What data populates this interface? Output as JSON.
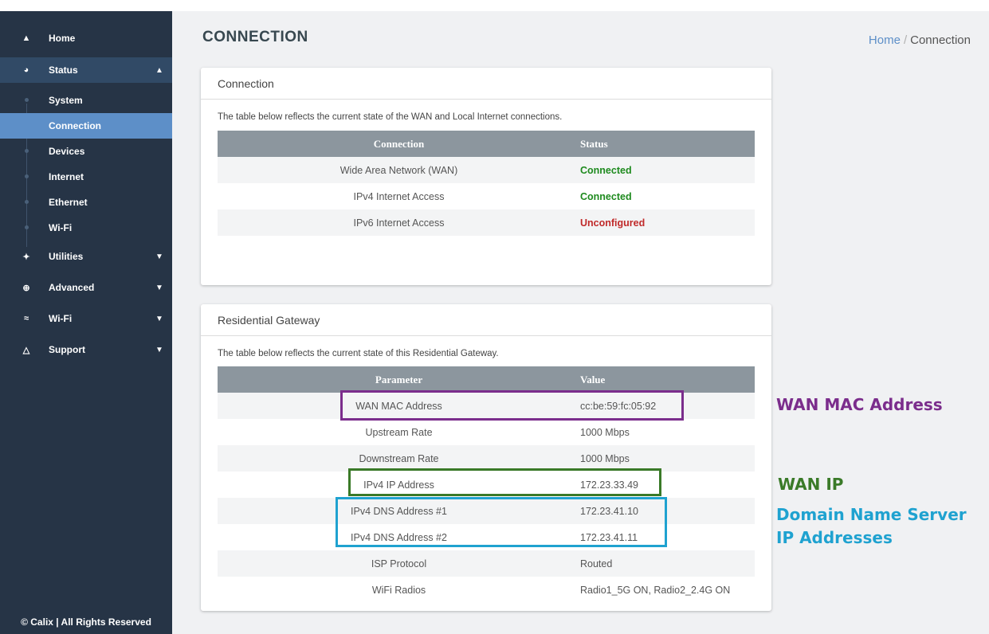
{
  "sidebar": {
    "home": "Home",
    "status": "Status",
    "status_sub": [
      "System",
      "Connection",
      "Devices",
      "Internet",
      "Ethernet",
      "Wi-Fi"
    ],
    "utilities": "Utilities",
    "advanced": "Advanced",
    "wifi": "Wi-Fi",
    "support": "Support",
    "footer": "© Calix | All Rights Reserved"
  },
  "header": {
    "title": "CONNECTION",
    "breadcrumb_home": "Home",
    "breadcrumb_sep": "/",
    "breadcrumb_current": "Connection"
  },
  "connection_panel": {
    "title": "Connection",
    "description": "The table below reflects the current state of the WAN and Local Internet connections.",
    "columns": [
      "Connection",
      "Status"
    ],
    "rows": [
      {
        "name": "Wide Area Network (WAN)",
        "status": "Connected"
      },
      {
        "name": "IPv4 Internet Access",
        "status": "Connected"
      },
      {
        "name": "IPv6 Internet Access",
        "status": "Unconfigured"
      }
    ]
  },
  "gateway_panel": {
    "title": "Residential Gateway",
    "description": "The table below reflects the current state of this Residential Gateway.",
    "columns": [
      "Parameter",
      "Value"
    ],
    "rows": [
      {
        "param": "WAN MAC Address",
        "value": "cc:be:59:fc:05:92"
      },
      {
        "param": "Upstream Rate",
        "value": "1000 Mbps"
      },
      {
        "param": "Downstream Rate",
        "value": "1000 Mbps"
      },
      {
        "param": "IPv4 IP Address",
        "value": "172.23.33.49"
      },
      {
        "param": "IPv4 DNS Address #1",
        "value": "172.23.41.10"
      },
      {
        "param": "IPv4 DNS Address #2",
        "value": "172.23.41.11"
      },
      {
        "param": "ISP Protocol",
        "value": "Routed"
      },
      {
        "param": "WiFi Radios",
        "value": "Radio1_5G ON, Radio2_2.4G ON"
      }
    ]
  },
  "annotations": {
    "wan_mac": "WAN MAC Address",
    "wan_ip": "WAN IP",
    "dns_line1": "Domain Name Server",
    "dns_line2": "IP Addresses"
  },
  "colors": {
    "sidebar_bg": "#263446",
    "active_item": "#5d8fc8",
    "connected": "#1e8a1e",
    "unconfigured": "#c02a2a",
    "mac_box": "#7b2d8c",
    "ip_box": "#3a7a28",
    "dns_box": "#1fa2d0"
  },
  "icons": {
    "home": "home-icon",
    "status": "dashboard-icon",
    "utilities": "wrench-icon",
    "advanced": "globe-icon",
    "wifi": "wifi-icon",
    "support": "cloud-icon"
  }
}
